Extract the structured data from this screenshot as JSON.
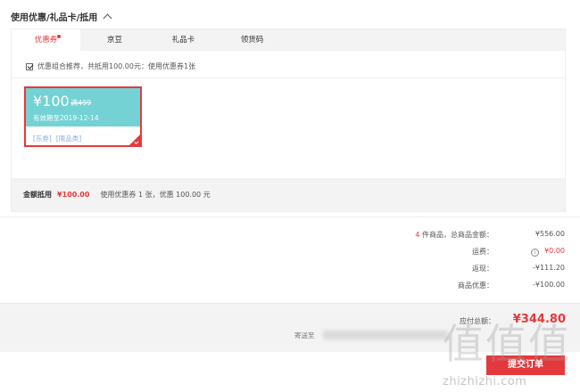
{
  "section": {
    "title": "使用优惠/礼品卡/抵用"
  },
  "tabs": [
    {
      "label": "优惠券",
      "active": true
    },
    {
      "label": "京豆",
      "active": false
    },
    {
      "label": "礼品卡",
      "active": false
    },
    {
      "label": "领货码",
      "active": false
    }
  ],
  "recommend": {
    "checked": true,
    "text": "优惠组合推荐，共抵用100.00元：使用优惠券1张"
  },
  "coupon": {
    "amount": "¥100",
    "condition": "满499",
    "valid_until": "有效期至2019-12-14",
    "tags": [
      "[东券]",
      "[限品类]"
    ],
    "selected": true,
    "color": "#74d2d4"
  },
  "deduction": {
    "label": "金额抵用",
    "amount": "¥100.00",
    "desc": "使用优惠券 1 张，优惠 100.00 元"
  },
  "totals": {
    "item_count": "4",
    "items_label": "件商品，总商品金额：",
    "items_total": "¥556.00",
    "shipping_label": "运费：",
    "shipping_icon": "i",
    "shipping_value": "¥0.00",
    "rebate_label": "返现：",
    "rebate_value": "-¥111.20",
    "discount_label": "商品优惠：",
    "discount_value": "-¥100.00"
  },
  "footer": {
    "pay_label": "应付总额：",
    "pay_amount": "¥344.80",
    "ship_to_label": "寄送至"
  },
  "submit": {
    "label": "提交订单"
  },
  "watermark": {
    "glyphs": "值值值",
    "text": "zhizhizhi.com"
  },
  "colors": {
    "accent": "#e4393c",
    "coupon": "#74d2d4",
    "panel_bg": "#f3f3f3"
  }
}
